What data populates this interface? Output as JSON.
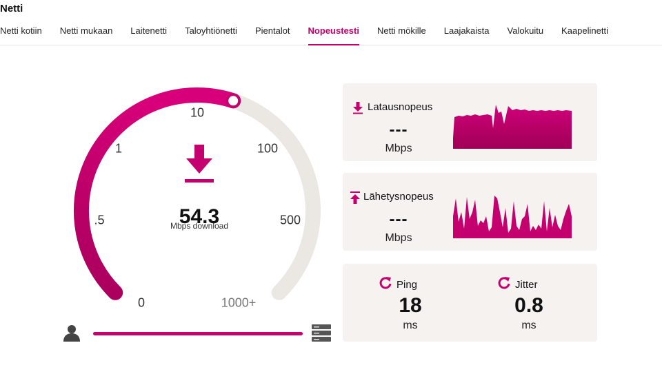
{
  "header": {
    "brand": "Netti",
    "tabs": [
      {
        "label": "Netti kotiin"
      },
      {
        "label": "Netti mukaan"
      },
      {
        "label": "Laitenetti"
      },
      {
        "label": "Taloyhtiönetti"
      },
      {
        "label": "Pientalot"
      },
      {
        "label": "Nopeustesti",
        "active": true
      },
      {
        "label": "Netti mökille"
      },
      {
        "label": "Laajakaista"
      },
      {
        "label": "Valokuitu"
      },
      {
        "label": "Kaapelinetti"
      }
    ]
  },
  "colors": {
    "accent": "#c4006e",
    "gauge_track": "#ebe7e3",
    "card_bg": "#f5f2f0"
  },
  "gauge": {
    "scale_labels": [
      "0",
      ".5",
      "1",
      "10",
      "100",
      "500",
      "1000+"
    ],
    "value": "54.3",
    "unit": "Mbps download",
    "fill_fraction": 0.5,
    "icon": "download-arrow-icon"
  },
  "connection_progress": {
    "fraction": 1.0,
    "left_icon": "user-icon",
    "right_icon": "server-icon"
  },
  "download": {
    "title": "Latausnopeus",
    "value": "---",
    "unit": "Mbps",
    "icon": "download-icon"
  },
  "upload": {
    "title": "Lähetysnopeus",
    "value": "---",
    "unit": "Mbps",
    "icon": "upload-icon"
  },
  "ping": {
    "title": "Ping",
    "value": "18",
    "unit": "ms",
    "icon": "refresh-icon"
  },
  "jitter": {
    "title": "Jitter",
    "value": "0.8",
    "unit": "ms",
    "icon": "refresh-icon"
  }
}
